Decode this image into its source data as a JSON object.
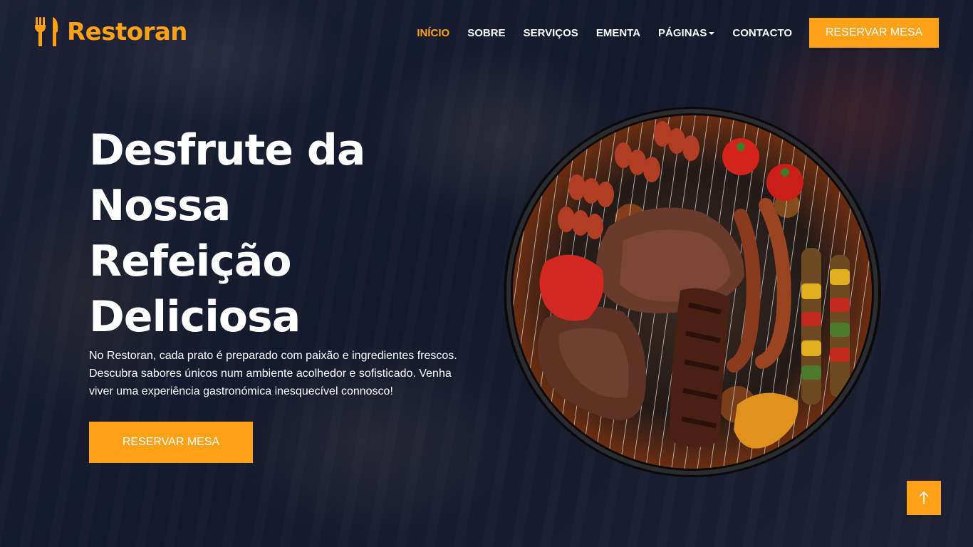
{
  "brand": {
    "name": "Restoran",
    "icon": "utensils-icon",
    "accent": "#fea116"
  },
  "nav": {
    "items": [
      {
        "label": "INÍCIO",
        "active": true
      },
      {
        "label": "SOBRE"
      },
      {
        "label": "SERVIÇOS"
      },
      {
        "label": "EMENTA"
      },
      {
        "label": "PÁGINAS",
        "dropdown": true
      },
      {
        "label": "CONTACTO"
      }
    ],
    "cta": "RESERVAR MESA"
  },
  "hero": {
    "title_lines": [
      "Desfrute da",
      "Nossa",
      "Refeição",
      "Deliciosa"
    ],
    "text_lines": [
      "No Restoran, cada prato é preparado com paixão e ingredientes frescos.",
      "Descubra sabores únicos num ambiente acolhedor e sofisticado. Venha",
      "viver uma experiência gastronómica inesquecível connosco!"
    ],
    "button": "RESERVAR MESA",
    "image": "grilled-bbq-platter"
  },
  "back_to_top": {
    "icon": "arrow-up-icon"
  }
}
